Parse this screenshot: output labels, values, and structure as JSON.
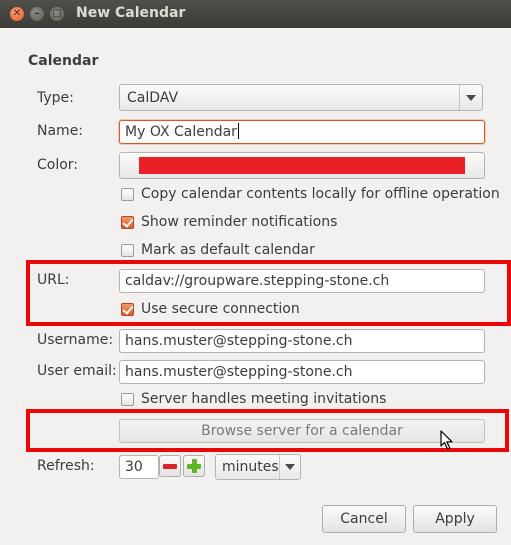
{
  "window": {
    "title": "New Calendar",
    "close_glyph": "✕",
    "minimize_glyph": "–",
    "maximize_glyph": "□"
  },
  "section": {
    "title": "Calendar"
  },
  "type": {
    "label": "Type:",
    "value": "CalDAV",
    "icon": "chevron-down-icon"
  },
  "name": {
    "label": "Name:",
    "value": "My OX Calendar"
  },
  "color": {
    "label": "Color:",
    "value": "#ea2026"
  },
  "options": {
    "offline": {
      "label": "Copy calendar contents locally for offline operation",
      "checked": false
    },
    "reminders": {
      "label": "Show reminder notifications",
      "checked": true
    },
    "default": {
      "label": "Mark as default calendar",
      "checked": false
    }
  },
  "url": {
    "label": "URL:",
    "value": "caldav://groupware.stepping-stone.ch"
  },
  "secure": {
    "label": "Use secure connection",
    "checked": true
  },
  "username": {
    "label": "Username:",
    "value": "hans.muster@stepping-stone.ch"
  },
  "user_email": {
    "label": "User email:",
    "value": "hans.muster@stepping-stone.ch"
  },
  "meeting": {
    "label": "Server handles meeting invitations",
    "checked": false
  },
  "browse": {
    "label": "Browse server for a calendar"
  },
  "refresh": {
    "label": "Refresh:",
    "value": "30",
    "unit": "minutes"
  },
  "buttons": {
    "cancel": "Cancel",
    "apply": "Apply"
  },
  "colors": {
    "highlight": "#ea0707",
    "accent": "#e9541e",
    "minus": "#d8242b",
    "plus": "#5eb42a"
  }
}
